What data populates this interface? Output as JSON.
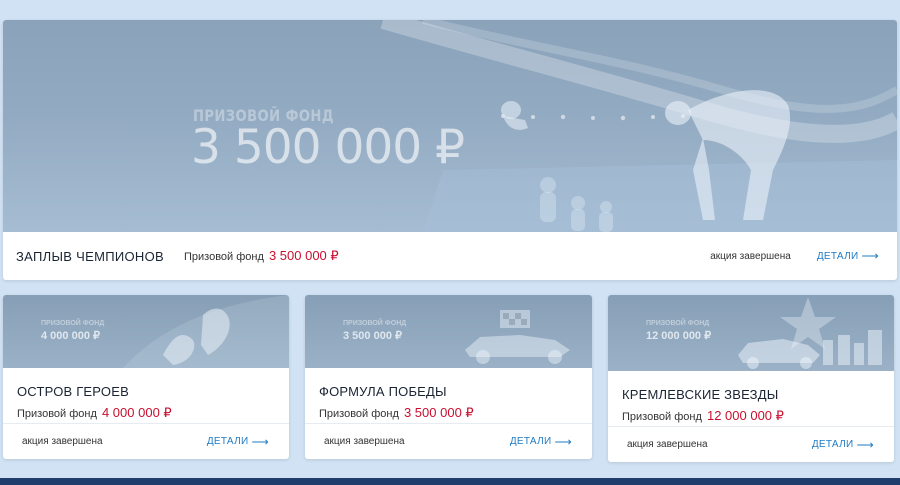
{
  "hero": {
    "banner_caption": "ПРИЗОВОЙ ФОНД",
    "banner_amount": "3 500 000 ₽",
    "title": "ЗАПЛЫВ ЧЕМПИОНОВ",
    "prize_label": "Призовой фонд",
    "prize_value": "3 500 000 ₽",
    "status": "акция завершена",
    "details_label": "ДЕТАЛИ"
  },
  "cards": [
    {
      "banner_caption": "ПРИЗОВОЙ ФОНД",
      "banner_amount": "4 000 000 ₽",
      "title": "ОСТРОВ ГЕРОЕВ",
      "prize_label": "Призовой фонд",
      "prize_value": "4 000 000 ₽",
      "status": "акция завершена",
      "details_label": "ДЕТАЛИ"
    },
    {
      "banner_caption": "ПРИЗОВОЙ ФОНД",
      "banner_amount": "3 500 000 ₽",
      "title": "ФОРМУЛА ПОБЕДЫ",
      "prize_label": "Призовой фонд",
      "prize_value": "3 500 000 ₽",
      "status": "акция завершена",
      "details_label": "ДЕТАЛИ"
    },
    {
      "banner_caption": "ПРИЗОВОЙ ФОНД",
      "banner_amount": "12 000 000 ₽",
      "title": "КРЕМЛЕВСКИЕ ЗВЕЗДЫ",
      "prize_label": "Призовой фонд",
      "prize_value": "12 000 000 ₽",
      "status": "акция завершена",
      "details_label": "ДЕТАЛИ"
    }
  ],
  "icons": {
    "arrow": "arrow-right-icon"
  },
  "colors": {
    "accent_red": "#c8102e",
    "link_blue": "#1f7bc4",
    "page_bg": "#d0e2f3",
    "footer": "#1f3e6e"
  }
}
